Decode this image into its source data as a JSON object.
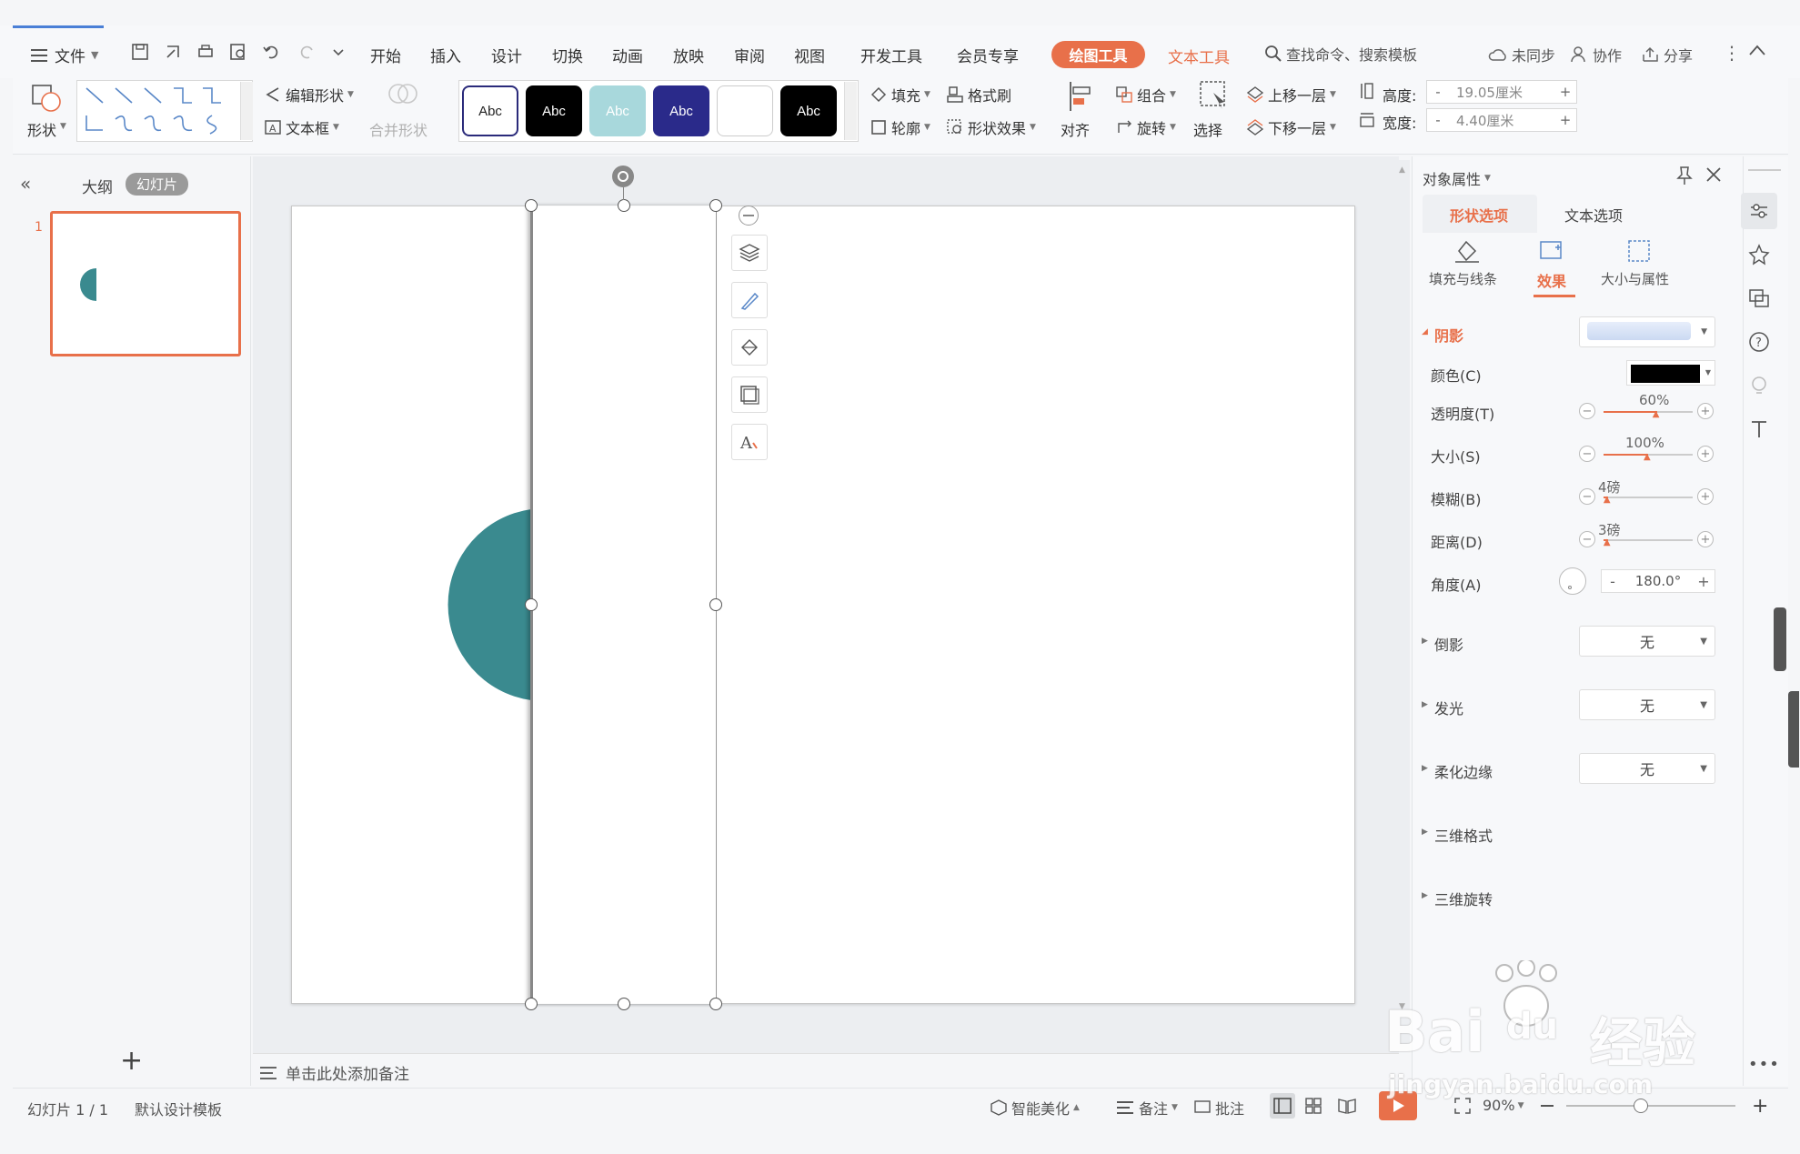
{
  "menu": {
    "file": "文件",
    "tabs": [
      "开始",
      "插入",
      "设计",
      "切换",
      "动画",
      "放映",
      "审阅",
      "视图",
      "开发工具",
      "会员专享"
    ],
    "context_active": "绘图工具",
    "context_other": "文本工具",
    "search": "查找命令、搜索模板",
    "sync": "未同步",
    "collab": "协作",
    "share": "分享"
  },
  "ribbon": {
    "shape": "形状",
    "edit_shape": "编辑形状",
    "textbox": "文本框",
    "merge_shape": "合并形状",
    "styles": [
      "Abc",
      "Abc",
      "Abc",
      "Abc",
      "",
      "Abc"
    ],
    "fill": "填充",
    "format_painter": "格式刷",
    "outline": "轮廓",
    "shape_effect": "形状效果",
    "align": "对齐",
    "group": "组合",
    "rotate": "旋转",
    "select": "选择",
    "bring_forward": "上移一层",
    "send_backward": "下移一层",
    "height_label": "高度:",
    "height_value": "19.05厘米",
    "width_label": "宽度:",
    "width_value": "4.40厘米",
    "minus": "-",
    "plus": "+"
  },
  "left_panel": {
    "outline_tab": "大纲",
    "slides_tab": "幻灯片",
    "slide_number": "1",
    "add": "+"
  },
  "canvas": {
    "notes_placeholder": "单击此处添加备注",
    "shape_color": "#3a8a8f"
  },
  "right_panel": {
    "title": "对象属性",
    "tab_shape": "形状选项",
    "tab_text": "文本选项",
    "sub_fill": "填充与线条",
    "sub_effect": "效果",
    "sub_size": "大小与属性",
    "shadow": "阴影",
    "color": "颜色(C)",
    "transparency": "透明度(T)",
    "transparency_value": "60%",
    "transparency_level": 0.6,
    "size": "大小(S)",
    "size_value": "100%",
    "size_level": 0.5,
    "blur": "模糊(B)",
    "blur_value": "4磅",
    "blur_level": 0.05,
    "distance": "距离(D)",
    "distance_value": "3磅",
    "distance_level": 0.05,
    "angle": "角度(A)",
    "angle_value": "180.0°",
    "reflection": "倒影",
    "glow": "发光",
    "soft_edge": "柔化边缘",
    "three_d_format": "三维格式",
    "three_d_rotation": "三维旋转",
    "none": "无"
  },
  "status": {
    "slide_info": "幻灯片 1 / 1",
    "template": "默认设计模板",
    "smart": "智能美化",
    "notes": "备注",
    "comments": "批注",
    "zoom": "90%"
  },
  "watermark": {
    "brand": "Bai",
    "du": "du",
    "cn": "经验",
    "url": "jingyan.baidu.com"
  },
  "colors": {
    "accent": "#e8704a",
    "teal": "#3a8a8f"
  }
}
